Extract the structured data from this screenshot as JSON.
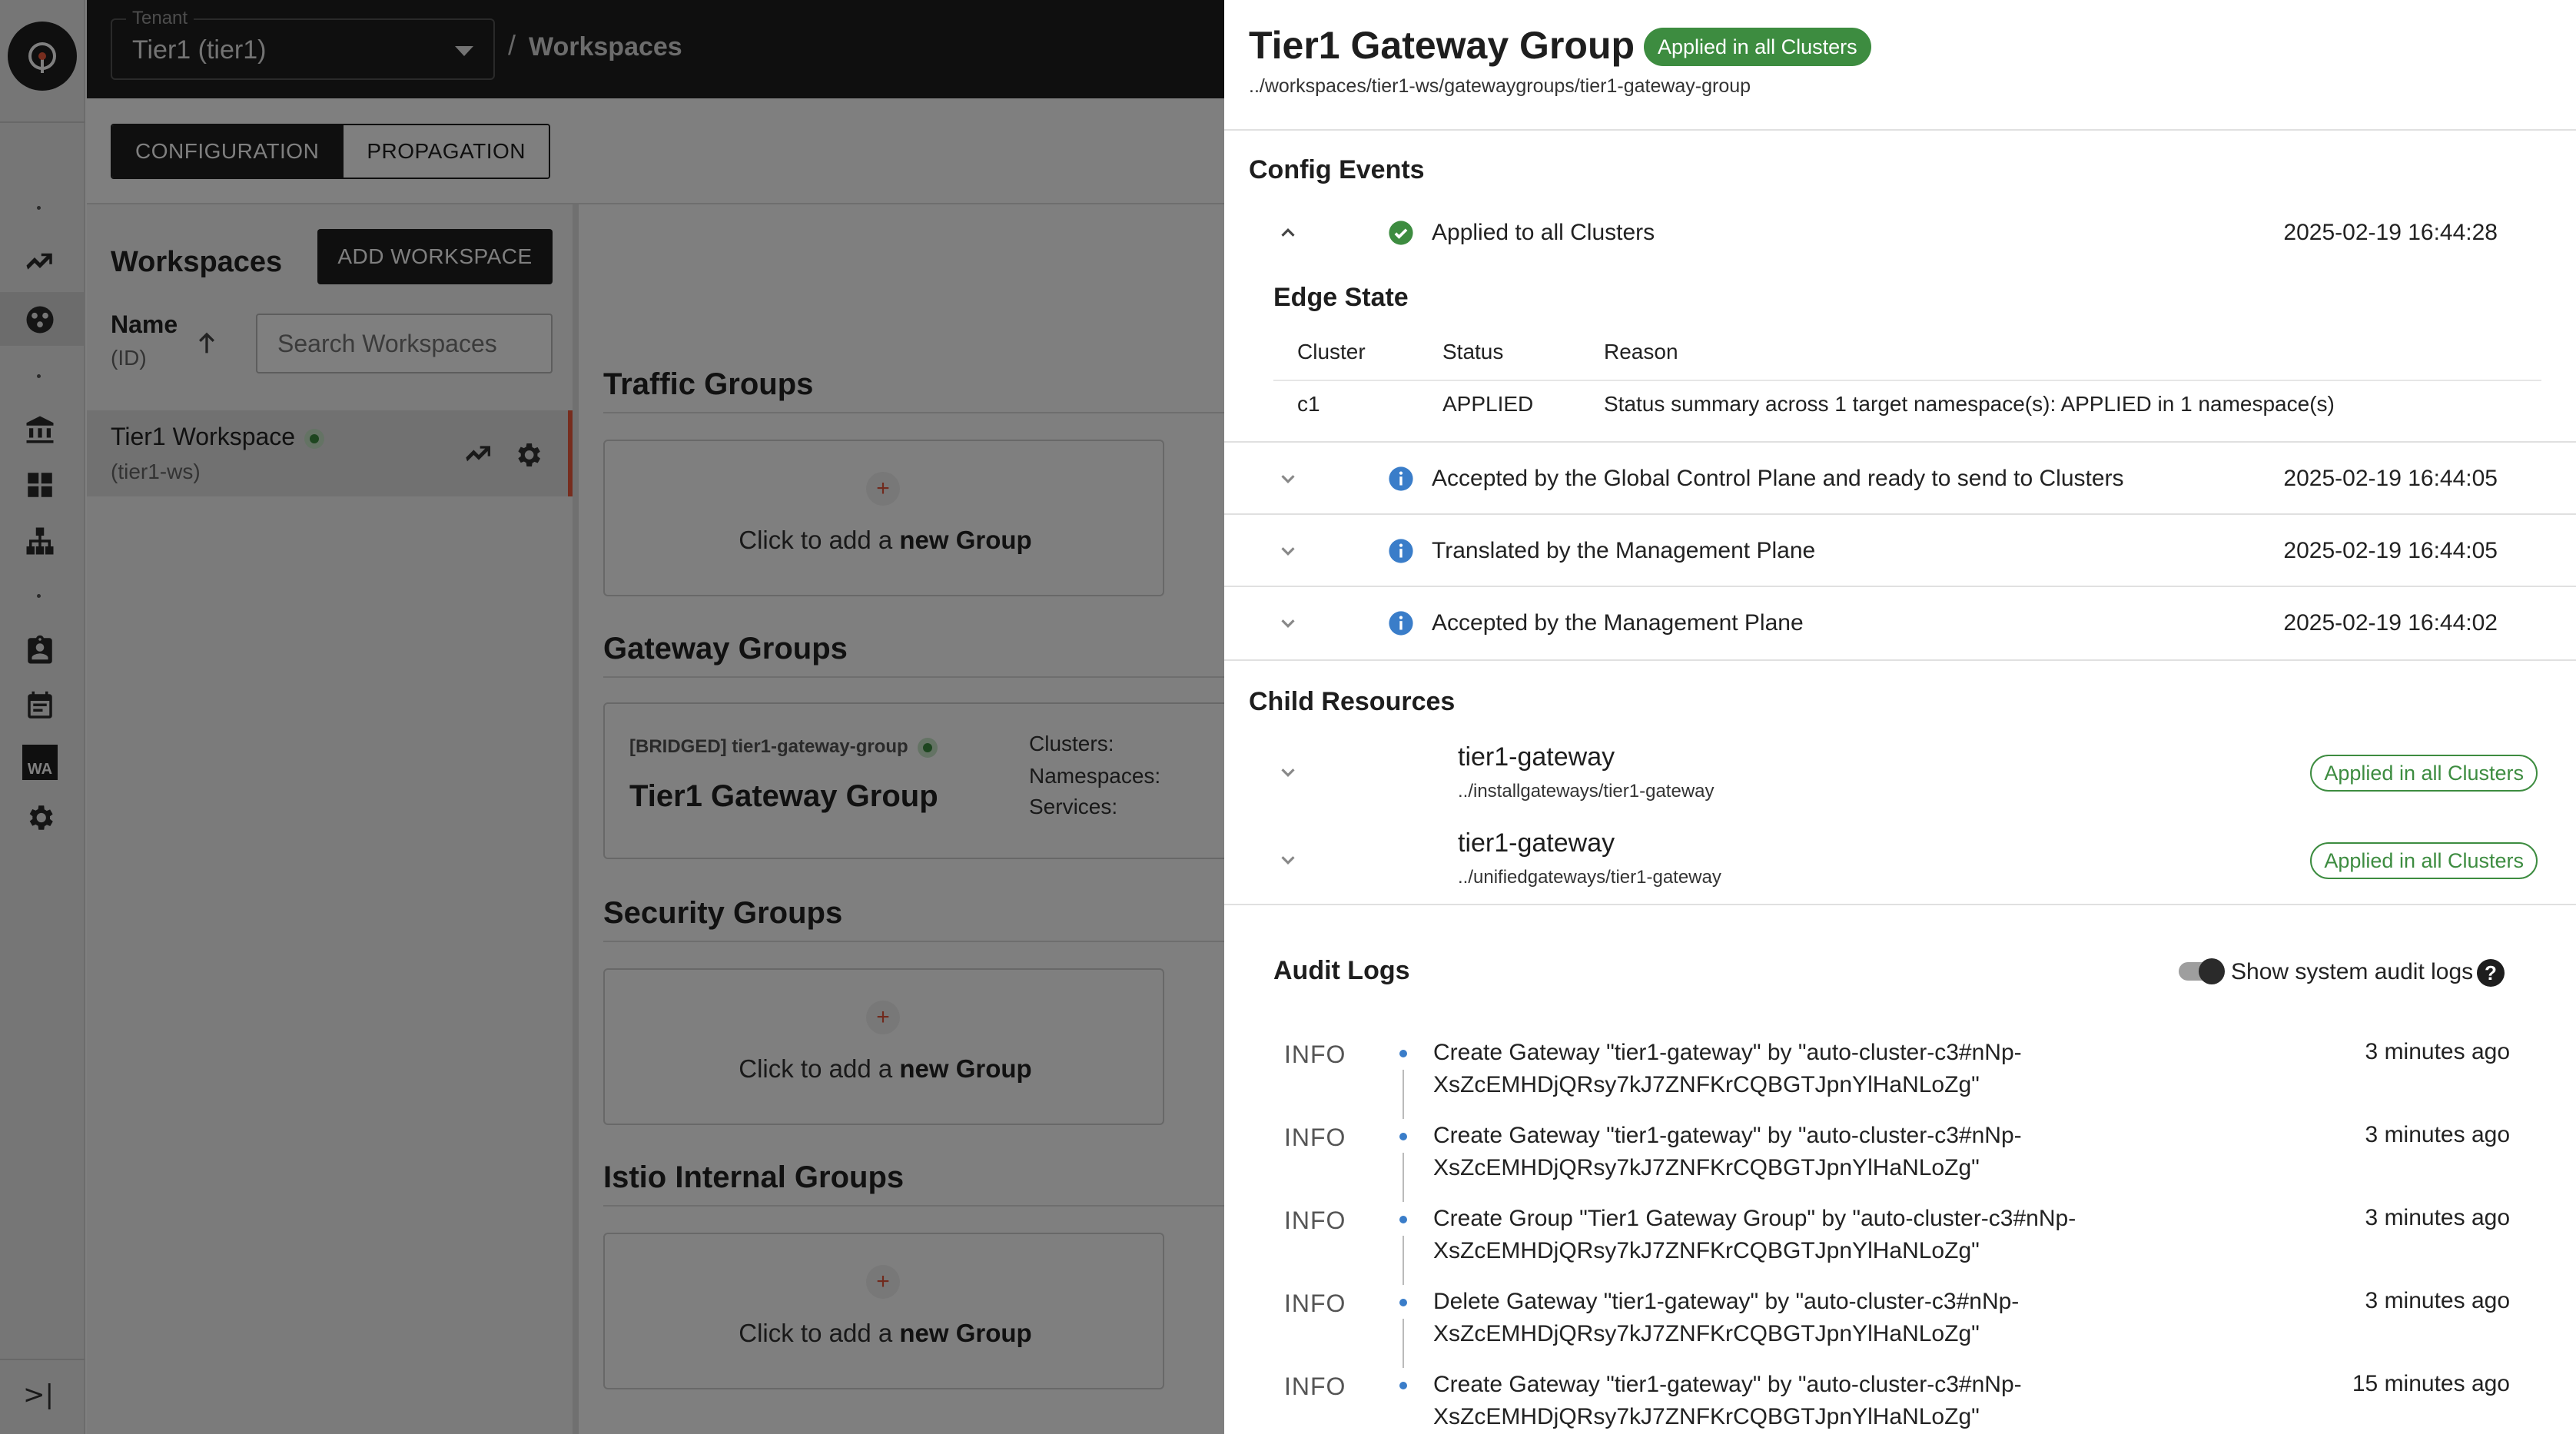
{
  "header": {
    "tenant_label": "Tenant",
    "tenant_value": "Tier1 (tier1)",
    "breadcrumb_sep": "/",
    "breadcrumb_page": "Workspaces"
  },
  "tabs": {
    "configuration": "CONFIGURATION",
    "propagation": "PROPAGATION"
  },
  "workspaces": {
    "title": "Workspaces",
    "add_button": "ADD WORKSPACE",
    "col_name": "Name",
    "col_id": "(ID)",
    "search_placeholder": "Search Workspaces",
    "rows": [
      {
        "name": "Tier1 Workspace",
        "id": "(tier1-ws)"
      }
    ]
  },
  "groups": {
    "traffic": {
      "title": "Traffic Groups",
      "add_plus": "+",
      "add_prefix": "Click to add a ",
      "add_bold": "new Group"
    },
    "gateway": {
      "title": "Gateway Groups",
      "card_tag": "[BRIDGED] tier1-gateway-group",
      "card_name": "Tier1 Gateway Group",
      "clusters_label": "Clusters:",
      "namespaces_label": "Namespaces:",
      "services_label": "Services:"
    },
    "security": {
      "title": "Security Groups",
      "add_plus": "+",
      "add_prefix": "Click to add a ",
      "add_bold": "new Group"
    },
    "istio": {
      "title": "Istio Internal Groups",
      "add_plus": "+",
      "add_prefix": "Click to add a ",
      "add_bold": "new Group"
    }
  },
  "drawer": {
    "title": "Tier1 Gateway Group",
    "badge": "Applied in all Clusters",
    "path": "../workspaces/tier1-ws/gatewaygroups/tier1-gateway-group",
    "config_events_title": "Config Events",
    "events": [
      {
        "text": "Applied to all Clusters",
        "time": "2025-02-19 16:44:28"
      },
      {
        "text": "Accepted by the Global Control Plane and ready to send to Clusters",
        "time": "2025-02-19 16:44:05"
      },
      {
        "text": "Translated by the Management Plane",
        "time": "2025-02-19 16:44:05"
      },
      {
        "text": "Accepted by the Management Plane",
        "time": "2025-02-19 16:44:02"
      }
    ],
    "edge_state": {
      "title": "Edge State",
      "headers": {
        "cluster": "Cluster",
        "status": "Status",
        "reason": "Reason"
      },
      "row": {
        "cluster": "c1",
        "status": "APPLIED",
        "reason": "Status summary across 1 target namespace(s): APPLIED in 1 namespace(s)"
      }
    },
    "child_title": "Child Resources",
    "children": [
      {
        "name": "tier1-gateway",
        "path": "../installgateways/tier1-gateway",
        "badge": "Applied in all Clusters"
      },
      {
        "name": "tier1-gateway",
        "path": "../unifiedgateways/tier1-gateway",
        "badge": "Applied in all Clusters"
      }
    ],
    "audit": {
      "title": "Audit Logs",
      "toggle_label": "Show system audit logs",
      "help": "?",
      "logs": [
        {
          "level": "INFO",
          "line1": "Create Gateway \"tier1-gateway\" by \"auto-cluster-c3#nNp-",
          "line2": "XsZcEMHDjQRsy7kJ7ZNFKrCQBGTJpnYlHaNLoZg\"",
          "time": "3 minutes ago"
        },
        {
          "level": "INFO",
          "line1": "Create Gateway \"tier1-gateway\" by \"auto-cluster-c3#nNp-",
          "line2": "XsZcEMHDjQRsy7kJ7ZNFKrCQBGTJpnYlHaNLoZg\"",
          "time": "3 minutes ago"
        },
        {
          "level": "INFO",
          "line1": "Create Group \"Tier1 Gateway Group\" by \"auto-cluster-c3#nNp-",
          "line2": "XsZcEMHDjQRsy7kJ7ZNFKrCQBGTJpnYlHaNLoZg\"",
          "time": "3 minutes ago"
        },
        {
          "level": "INFO",
          "line1": "Delete Gateway \"tier1-gateway\" by \"auto-cluster-c3#nNp-",
          "line2": "XsZcEMHDjQRsy7kJ7ZNFKrCQBGTJpnYlHaNLoZg\"",
          "time": "3 minutes ago"
        },
        {
          "level": "INFO",
          "line1": "Create Gateway \"tier1-gateway\" by \"auto-cluster-c3#nNp-",
          "line2": "XsZcEMHDjQRsy7kJ7ZNFKrCQBGTJpnYlHaNLoZg\"",
          "time": "15 minutes ago"
        }
      ]
    }
  },
  "rail": {
    "wa_label": "WA",
    "expand_glyph": ">|"
  },
  "colors": {
    "success": "#3d8c40",
    "info": "#3a7dc9",
    "accent": "#ef5a3c",
    "header_bg": "#1e1e1e"
  }
}
